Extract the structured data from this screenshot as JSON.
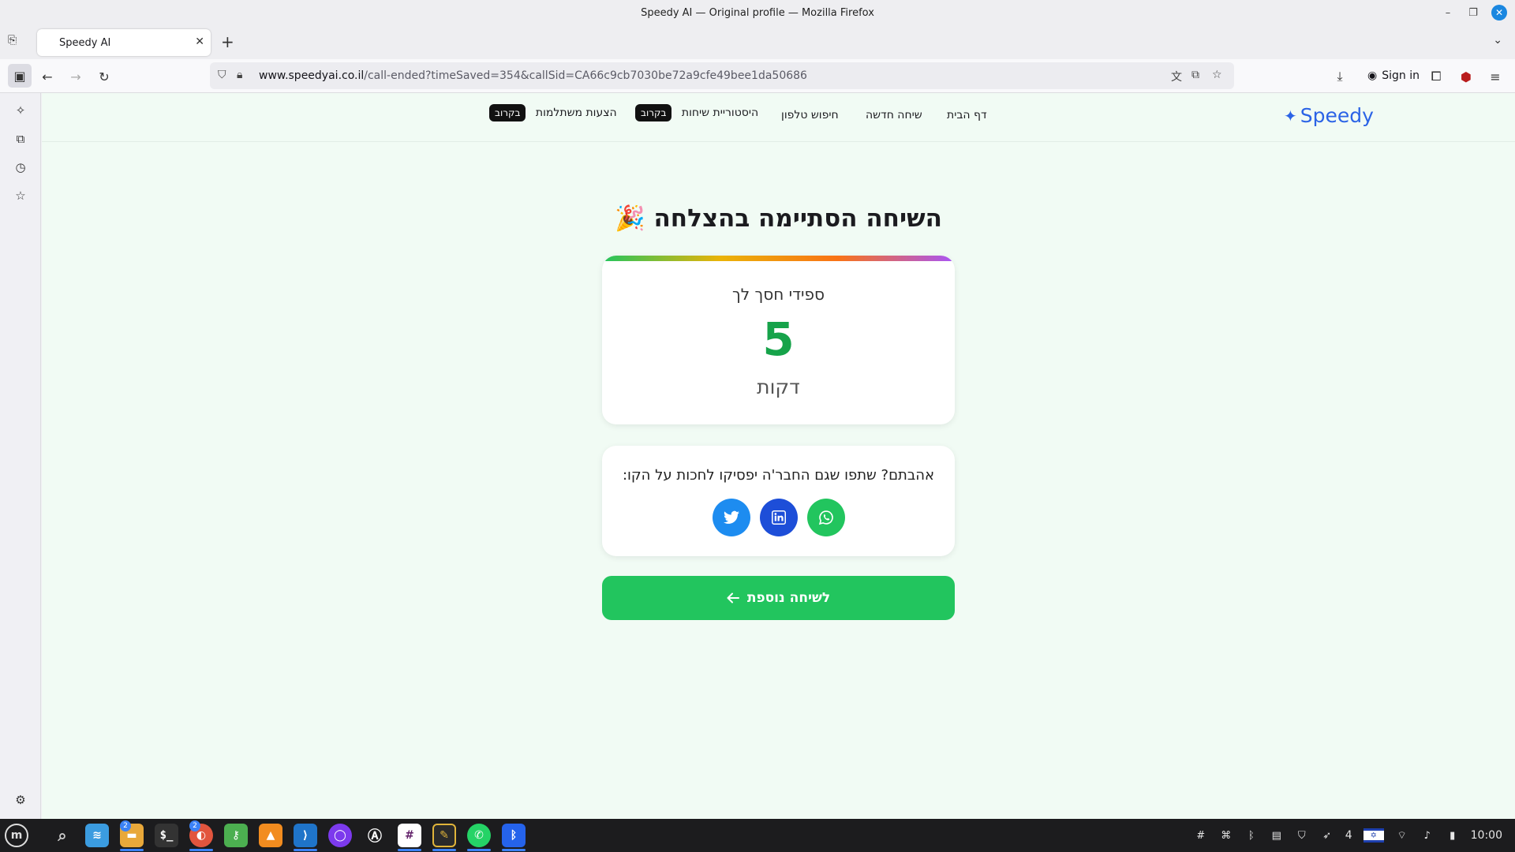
{
  "window": {
    "title": "Speedy AI — Original profile — Mozilla Firefox"
  },
  "tabs": [
    {
      "label": "Speedy AI"
    }
  ],
  "urlbar": {
    "host": "www.speedyai.co.il",
    "path": "/call-ended?timeSaved=354&callSid=CA66c9cb7030be72a9cfe49bee1da50686"
  },
  "toolbar": {
    "signin_label": "Sign in"
  },
  "site": {
    "logo": "Speedy",
    "nav": {
      "home": "דף הבית",
      "new_call": "שיחה חדשה",
      "phone_search": "חיפוש טלפון",
      "call_history": "היסטוריית שיחות",
      "suggestions": "הצעות משתלמות",
      "soon_badge": "בקרוב"
    }
  },
  "main": {
    "headline": "השיחה הסתיימה בהצלחה 🎉",
    "saved": {
      "label": "ספידי חסך לך",
      "value": "5",
      "unit": "דקות"
    },
    "share": {
      "prompt": "אהבתם? שתפו שגם החבר'ה יפסיקו לחכות על הקו:"
    },
    "cta_label": "לשיחה נוספת"
  },
  "taskbar": {
    "badges": {
      "files": "2",
      "app": "2"
    },
    "workspace_count": "4",
    "clock": "10:00"
  },
  "colors": {
    "brand_blue": "#2b63e6",
    "success_green": "#22c55e",
    "value_green": "#16a34a",
    "twitter": "#1d8cf0",
    "linkedin": "#1d4ed8",
    "whatsapp": "#22c55e"
  },
  "icons": [
    "twitter-icon",
    "linkedin-icon",
    "whatsapp-icon",
    "arrow-left-icon",
    "sparkle-icon"
  ]
}
